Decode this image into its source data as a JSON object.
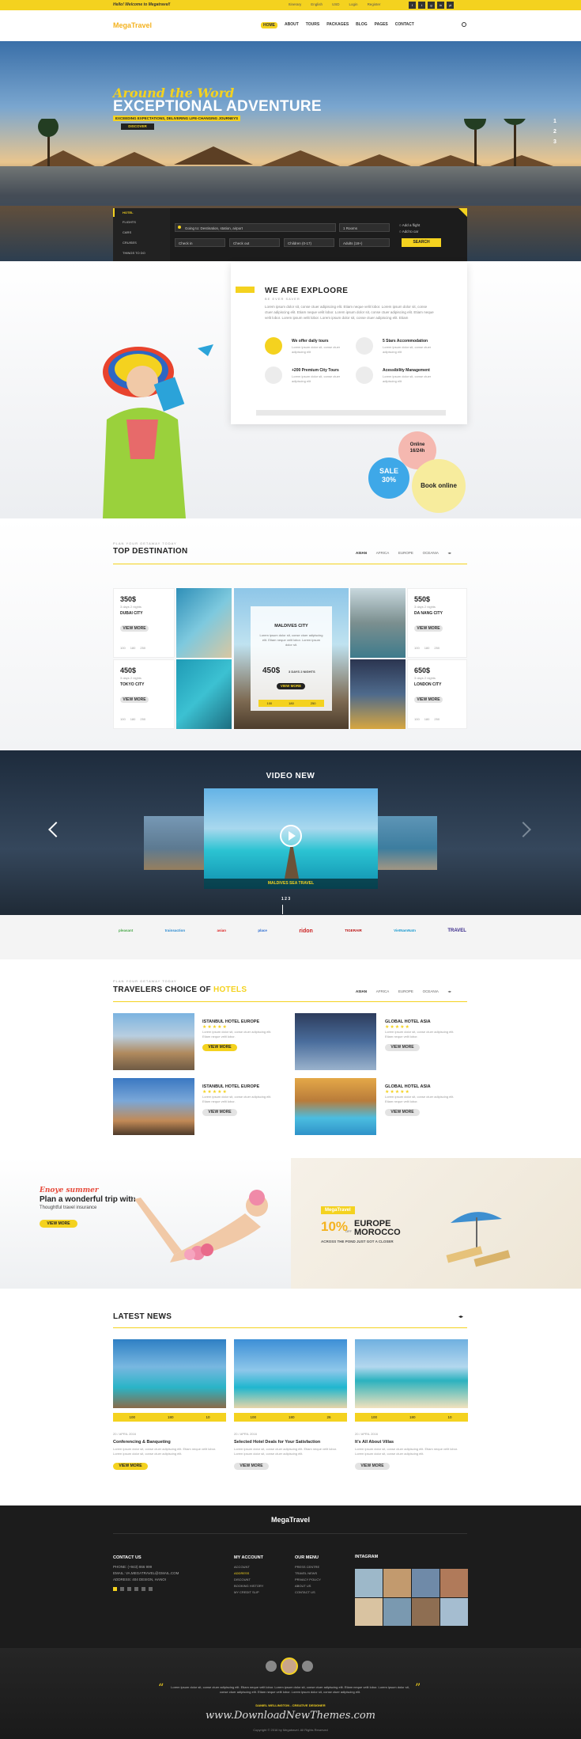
{
  "topbar": {
    "welcome": "Hello! Welcome to Megatravel!",
    "links": [
      "Itinerary",
      "English",
      "USD",
      "Login",
      "Register"
    ],
    "social": [
      "f",
      "t",
      "g",
      "in",
      "yt"
    ]
  },
  "nav": {
    "logo": "MegaTravel",
    "items": [
      "HOME",
      "ABOUT",
      "TOURS",
      "PACKAGES",
      "BLOG",
      "PAGES",
      "CONTACT"
    ]
  },
  "hero": {
    "script": "Around the Word",
    "title": "EXCEPTIONAL ADVENTURE",
    "subtitle": "EXCEEDING EXPECTATIONS, DELIVERING LIFE-CHANGING JOURNEYS",
    "button": "DISCOVER",
    "pager": [
      "1",
      "2",
      "3"
    ]
  },
  "search": {
    "tabs": [
      "HOTEL",
      "FLIGHTS",
      "CARS",
      "CRUISES",
      "THINGS TO DO"
    ],
    "destination": "Going to: Destination, station, airport",
    "rooms": "1 Rooms",
    "checkin": "Check in",
    "checkout": "Check out",
    "children": "Children (0-17)",
    "adults": "Adults (18+)",
    "opt1": "Add a flight",
    "opt2": "Add to car",
    "button": "SEARCH"
  },
  "explore": {
    "title": "WE ARE EXPLOORE",
    "sub": "BE EVER SAVER",
    "text": "Lorem ipsum dolor sit, conse ctuer adipiscing elit. Etiam neque velit lobor. Lorem ipsum dolor sit, conse ctuer adipiscing elit. Etiam neque velit lobor. Lorem ipsum dolor sit, conse ctuer adipiscing elit. Etiam neque velit lobor. Lorem ipsum velit lobor. Lorem ipsum dolor sit, conse ctuer adipiscing elit. Etiam",
    "features": [
      {
        "title": "We offer daily tours",
        "text": "Lorem ipsum dolor sit, conse ctuer adipiscing elit"
      },
      {
        "title": "5 Stars Accommodation",
        "text": "Lorem ipsum dolor sit, conse ctuer adipiscing elit"
      },
      {
        "title": "+200 Premium City Tours",
        "text": "Lorem ipsum dolor sit, conse ctuer adipiscing elit"
      },
      {
        "title": "Acessibility Management",
        "text": "Lorem ipsum dolor sit, conse ctuer adipiscing elit"
      }
    ],
    "badge_online": "Online 16/24h",
    "badge_sale": "SALE 30%",
    "badge_book": "Book online"
  },
  "dest": {
    "small": "PLAN YOUR GETAWAY TODAY",
    "title": "TOP DESTINATION",
    "tabs": [
      "ASIAN",
      "AFRICA",
      "EUROPE",
      "OCEANIA"
    ],
    "cards": [
      {
        "price": "350$",
        "days": "3 days 2 nights",
        "city": "DUBAI CITY",
        "btn": "VIEW MORE",
        "s": [
          "100",
          "180",
          "250"
        ]
      },
      {
        "price": "450$",
        "days": "3 days 2 nights",
        "city": "TOKYO CITY",
        "btn": "VIEW MORE",
        "s": [
          "100",
          "180",
          "250"
        ]
      },
      {
        "price": "550$",
        "days": "3 days 2 nights",
        "city": "DA NANG CITY",
        "btn": "VIEW MORE",
        "s": [
          "100",
          "180",
          "250"
        ]
      },
      {
        "price": "650$",
        "days": "3 days 2 nights",
        "city": "LONDON CITY",
        "btn": "VIEW MORE",
        "s": [
          "100",
          "180",
          "250"
        ]
      }
    ],
    "center": {
      "city": "MALDIVES CITY",
      "text": "Lorem ipsum dolor sit, conse ctuer adipiscing elit. Etiam neque velit lobor. Lorem ipsum dolor sit.",
      "price": "450$",
      "days": "3 DAYS 2 NIGHTS",
      "btn": "VIEW MORE",
      "s": [
        "100",
        "180",
        "250"
      ]
    }
  },
  "video": {
    "title": "VIDEO NEW",
    "caption": "MALDIVES SEA TRAVEL",
    "dots": "1  2  3"
  },
  "partners": [
    "pleasant",
    "trainsaction",
    "asian",
    "place",
    "ridon",
    "TIGERAIR",
    "VietNamNatn",
    "TRAVEL"
  ],
  "hotels": {
    "small": "PLAN YOUR GETAWAY TODAY",
    "title1": "TRAVELERS CHOICE OF",
    "title2": "HOTELS",
    "tabs": [
      "ASIAN",
      "AFRICA",
      "EUROPE",
      "OCEANIA"
    ],
    "items": [
      {
        "name": "ISTANBUL HOTEL EUROPE",
        "stars": "★★★★★",
        "text": "Lorem ipsum dolor sit, conse ctuer adipiscing elit. Etiam neque velit lobor.",
        "btn": "VIEW MORE"
      },
      {
        "name": "GLOBAL HOTEL ASIA",
        "stars": "★★★★★",
        "text": "Lorem ipsum dolor sit, conse ctuer adipiscing elit. Etiam neque velit lobor.",
        "btn": "VIEW MORE"
      },
      {
        "name": "ISTANBUL HOTEL EUROPE",
        "stars": "★★★★★",
        "text": "Lorem ipsum dolor sit, conse ctuer adipiscing elit. Etiam neque velit lobor.",
        "btn": "VIEW MORE"
      },
      {
        "name": "GLOBAL HOTEL ASIA",
        "stars": "★★★★★",
        "text": "Lorem ipsum dolor sit, conse ctuer adipiscing elit. Etiam neque velit lobor.",
        "btn": "VIEW MORE"
      }
    ]
  },
  "promo": {
    "script": "Enoye summer",
    "title": "Plan a wonderful trip with",
    "sub": "Thoughtful travel insurance",
    "btn": "VIEW MORE",
    "logo": "MegaTravel",
    "pct": "10%",
    "off": "OFF",
    "europe": "EUROPE",
    "morocco": "MOROCCO",
    "tag": "ACROSS THE POND JUST GOT A CLOSER"
  },
  "news": {
    "title": "LATEST NEWS",
    "items": [
      {
        "date": "20 / APRIL 2016",
        "title": "Conferencing & Banqueting",
        "text": "Lorem ipsum dolor sit, conse ctuer adipiscing elit. Etiam neque velit lobor. Lorem ipsum dolor sit, conse ctuer adipiscing elit.",
        "btn": "VIEW MORE",
        "s": [
          "100",
          "180",
          "10"
        ]
      },
      {
        "date": "20 / APRIL 2016",
        "title": "Selected Hotel Deals for Your Satisfaction",
        "text": "Lorem ipsum dolor sit, conse ctuer adipiscing elit. Etiam neque velit lobor. Lorem ipsum dolor sit, conse ctuer adipiscing elit.",
        "btn": "VIEW MORE",
        "s": [
          "100",
          "180",
          "26"
        ]
      },
      {
        "date": "20 / APRIL 2016",
        "title": "It's All About Villas",
        "text": "Lorem ipsum dolor sit, conse ctuer adipiscing elit. Etiam neque velit lobor. Lorem ipsum dolor sit, conse ctuer adipiscing elit.",
        "btn": "VIEW MORE",
        "s": [
          "100",
          "180",
          "10"
        ]
      }
    ]
  },
  "footer": {
    "logo": "MegaTravel",
    "contact_title": "CONTACT US",
    "phone": "PHONE: (+943) 866 999",
    "email": "EMAIL: VA.MEGATRAVEL@GMAIL.COM",
    "address": "ADDRESS: 404 DESIGN, HANOI",
    "account_title": "MY ACCOUNT",
    "account": [
      "ACCOUNT",
      "ADDRESS",
      "DISCOUNT",
      "BOOKING HISTORY",
      "MY CREDIT SLIP"
    ],
    "menu_title": "OUR MENU",
    "menu": [
      "PRESS CENTRE",
      "TRAVEL NEWS",
      "PRIVACY POLICY",
      "ABOUT US",
      "CONTACT US"
    ],
    "insta_title": "INTAGRAM",
    "quote": "Lorem ipsum dolor sit, conse ctuer adipiscing elit. Etiam neque velit lobor. Lorem ipsum dolor sit, conse ctuer adipiscing elit. Etiam neque velit lobor. Lorem ipsum dolor sit, conse ctuer adipiscing elit. Etiam neque velit lobor. Lorem ipsum dolor sit, conse ctuer adipiscing elit.",
    "author": "DANIEL WELLINGTON - CREATIVE DESIGNER",
    "watermark": "www.DownloadNewThemes.com",
    "copyright": "Copyright © 2016 by Megatravel. All Rights Reserved"
  }
}
